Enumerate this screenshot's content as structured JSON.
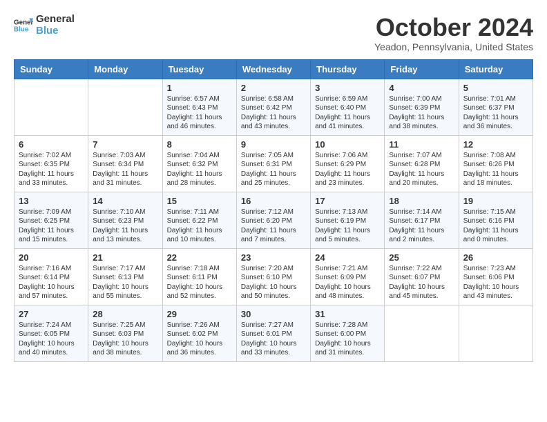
{
  "header": {
    "logo_line1": "General",
    "logo_line2": "Blue",
    "month_year": "October 2024",
    "location": "Yeadon, Pennsylvania, United States"
  },
  "days_of_week": [
    "Sunday",
    "Monday",
    "Tuesday",
    "Wednesday",
    "Thursday",
    "Friday",
    "Saturday"
  ],
  "weeks": [
    [
      {
        "day": "",
        "info": ""
      },
      {
        "day": "",
        "info": ""
      },
      {
        "day": "1",
        "info": "Sunrise: 6:57 AM\nSunset: 6:43 PM\nDaylight: 11 hours and 46 minutes."
      },
      {
        "day": "2",
        "info": "Sunrise: 6:58 AM\nSunset: 6:42 PM\nDaylight: 11 hours and 43 minutes."
      },
      {
        "day": "3",
        "info": "Sunrise: 6:59 AM\nSunset: 6:40 PM\nDaylight: 11 hours and 41 minutes."
      },
      {
        "day": "4",
        "info": "Sunrise: 7:00 AM\nSunset: 6:39 PM\nDaylight: 11 hours and 38 minutes."
      },
      {
        "day": "5",
        "info": "Sunrise: 7:01 AM\nSunset: 6:37 PM\nDaylight: 11 hours and 36 minutes."
      }
    ],
    [
      {
        "day": "6",
        "info": "Sunrise: 7:02 AM\nSunset: 6:35 PM\nDaylight: 11 hours and 33 minutes."
      },
      {
        "day": "7",
        "info": "Sunrise: 7:03 AM\nSunset: 6:34 PM\nDaylight: 11 hours and 31 minutes."
      },
      {
        "day": "8",
        "info": "Sunrise: 7:04 AM\nSunset: 6:32 PM\nDaylight: 11 hours and 28 minutes."
      },
      {
        "day": "9",
        "info": "Sunrise: 7:05 AM\nSunset: 6:31 PM\nDaylight: 11 hours and 25 minutes."
      },
      {
        "day": "10",
        "info": "Sunrise: 7:06 AM\nSunset: 6:29 PM\nDaylight: 11 hours and 23 minutes."
      },
      {
        "day": "11",
        "info": "Sunrise: 7:07 AM\nSunset: 6:28 PM\nDaylight: 11 hours and 20 minutes."
      },
      {
        "day": "12",
        "info": "Sunrise: 7:08 AM\nSunset: 6:26 PM\nDaylight: 11 hours and 18 minutes."
      }
    ],
    [
      {
        "day": "13",
        "info": "Sunrise: 7:09 AM\nSunset: 6:25 PM\nDaylight: 11 hours and 15 minutes."
      },
      {
        "day": "14",
        "info": "Sunrise: 7:10 AM\nSunset: 6:23 PM\nDaylight: 11 hours and 13 minutes."
      },
      {
        "day": "15",
        "info": "Sunrise: 7:11 AM\nSunset: 6:22 PM\nDaylight: 11 hours and 10 minutes."
      },
      {
        "day": "16",
        "info": "Sunrise: 7:12 AM\nSunset: 6:20 PM\nDaylight: 11 hours and 7 minutes."
      },
      {
        "day": "17",
        "info": "Sunrise: 7:13 AM\nSunset: 6:19 PM\nDaylight: 11 hours and 5 minutes."
      },
      {
        "day": "18",
        "info": "Sunrise: 7:14 AM\nSunset: 6:17 PM\nDaylight: 11 hours and 2 minutes."
      },
      {
        "day": "19",
        "info": "Sunrise: 7:15 AM\nSunset: 6:16 PM\nDaylight: 11 hours and 0 minutes."
      }
    ],
    [
      {
        "day": "20",
        "info": "Sunrise: 7:16 AM\nSunset: 6:14 PM\nDaylight: 10 hours and 57 minutes."
      },
      {
        "day": "21",
        "info": "Sunrise: 7:17 AM\nSunset: 6:13 PM\nDaylight: 10 hours and 55 minutes."
      },
      {
        "day": "22",
        "info": "Sunrise: 7:18 AM\nSunset: 6:11 PM\nDaylight: 10 hours and 52 minutes."
      },
      {
        "day": "23",
        "info": "Sunrise: 7:20 AM\nSunset: 6:10 PM\nDaylight: 10 hours and 50 minutes."
      },
      {
        "day": "24",
        "info": "Sunrise: 7:21 AM\nSunset: 6:09 PM\nDaylight: 10 hours and 48 minutes."
      },
      {
        "day": "25",
        "info": "Sunrise: 7:22 AM\nSunset: 6:07 PM\nDaylight: 10 hours and 45 minutes."
      },
      {
        "day": "26",
        "info": "Sunrise: 7:23 AM\nSunset: 6:06 PM\nDaylight: 10 hours and 43 minutes."
      }
    ],
    [
      {
        "day": "27",
        "info": "Sunrise: 7:24 AM\nSunset: 6:05 PM\nDaylight: 10 hours and 40 minutes."
      },
      {
        "day": "28",
        "info": "Sunrise: 7:25 AM\nSunset: 6:03 PM\nDaylight: 10 hours and 38 minutes."
      },
      {
        "day": "29",
        "info": "Sunrise: 7:26 AM\nSunset: 6:02 PM\nDaylight: 10 hours and 36 minutes."
      },
      {
        "day": "30",
        "info": "Sunrise: 7:27 AM\nSunset: 6:01 PM\nDaylight: 10 hours and 33 minutes."
      },
      {
        "day": "31",
        "info": "Sunrise: 7:28 AM\nSunset: 6:00 PM\nDaylight: 10 hours and 31 minutes."
      },
      {
        "day": "",
        "info": ""
      },
      {
        "day": "",
        "info": ""
      }
    ]
  ]
}
